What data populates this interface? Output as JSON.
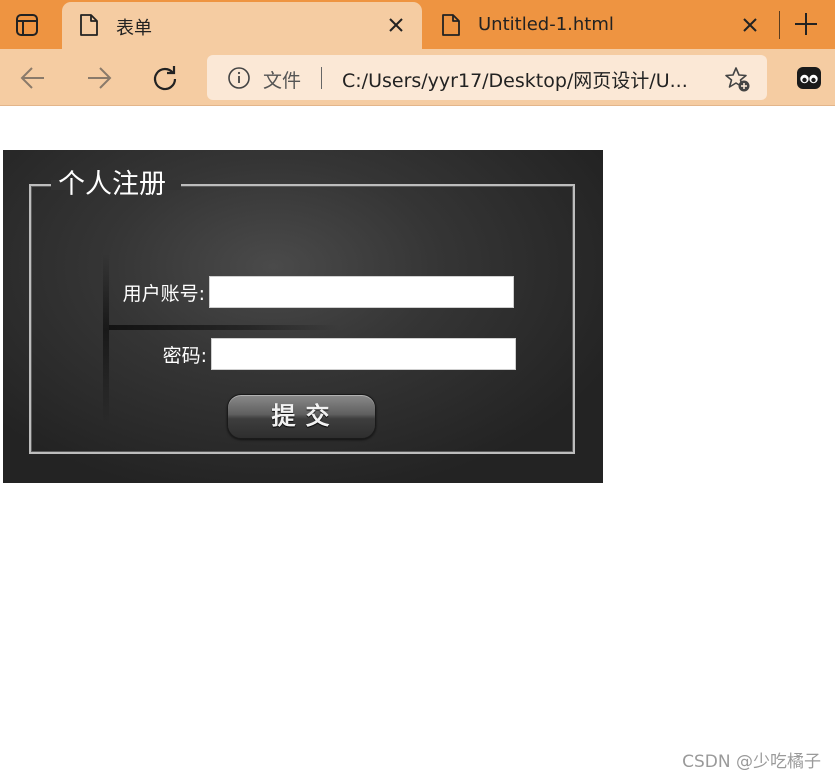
{
  "browser": {
    "tabs": [
      {
        "title": "表单",
        "active": true
      },
      {
        "title": "Untitled-1.html",
        "active": false
      }
    ],
    "address": {
      "scheme_label": "文件",
      "url": "C:/Users/yyr17/Desktop/网页设计/U..."
    },
    "icons": {
      "tab_actions": "tab-actions-icon",
      "page": "page-icon",
      "close": "close-icon",
      "new_tab": "plus-icon",
      "back": "arrow-left-icon",
      "forward": "arrow-right-icon",
      "reload": "reload-icon",
      "info": "info-icon",
      "favorite": "star-plus-icon",
      "extension": "extension-icon"
    },
    "colors": {
      "tab_strip": "#ee9441",
      "toolbar": "#f5cca2",
      "omnibox": "#fbe8d6"
    }
  },
  "form": {
    "legend": "个人注册",
    "username_label": "用户账号:",
    "password_label": "密码:",
    "username_value": "",
    "password_value": "",
    "submit_label": "提交"
  },
  "watermark": "CSDN @少吃橘子"
}
